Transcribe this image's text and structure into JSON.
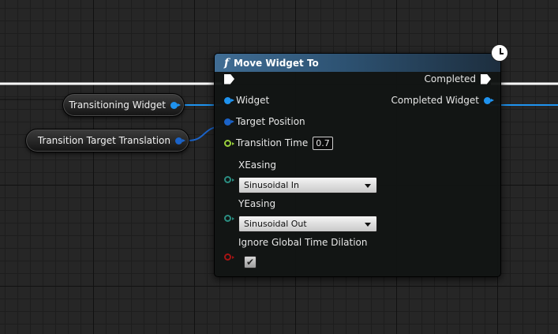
{
  "variables": [
    {
      "label": "Transitioning Widget"
    },
    {
      "label": "Transition Target Translation"
    }
  ],
  "node": {
    "title": "Move Widget To",
    "icon": "function-icon",
    "outputs": {
      "completed": "Completed",
      "completed_widget": "Completed Widget"
    },
    "inputs": {
      "widget": "Widget",
      "target_position": "Target Position",
      "transition_time": "Transition Time",
      "transition_time_value": "0.7",
      "x_easing": "XEasing",
      "x_easing_value": "Sinusoidal In",
      "y_easing": "YEasing",
      "y_easing_value": "Sinusoidal Out",
      "ignore_dilation": "Ignore Global Time Dilation",
      "ignore_dilation_checked": true
    }
  },
  "colors": {
    "object_pin": "#1f93ef",
    "vector_pin": "#1b63c8",
    "float_pin": "#9ad13c",
    "enum_pin": "#2b8e82",
    "bool_pin": "#a51414",
    "header": "#406d94"
  }
}
